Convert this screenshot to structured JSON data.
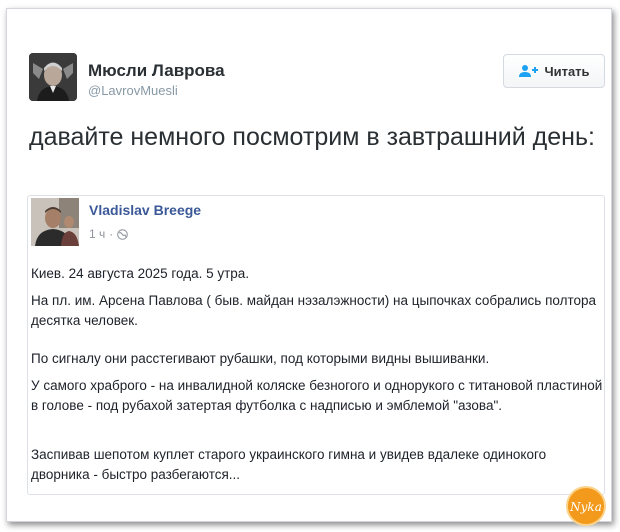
{
  "author": {
    "name": "Мюсли Лаврова",
    "handle": "@LavrovMuesli"
  },
  "follow_button": {
    "label": "Читать",
    "icon": "add-user-icon"
  },
  "tweet": {
    "text": "давайте немного посмотрим в завтрашний день:"
  },
  "embedded_post": {
    "author": "Vladislav Breege",
    "time": "1 ч",
    "visibility_icon": "globe-icon",
    "paragraphs": [
      "Киев. 24 августа 2025 года. 5 утра.",
      "На пл. им. Арсена Павлова ( быв. майдан нэзалэжности) на цыпочках собрались полтора десятка человек.",
      "По сигналу они расстегивают рубашки, под которыми видны вышиванки.",
      "У самого храброго - на инвалидной коляске безногого и однорукого с титановой пластиной в голове - под рубахой затертая футболка с надписью и эмблемой \"азова\".",
      "Заспивав шепотом куплет старого украинского гимна и увидев вдалеке одинокого дворника - быстро разбегаются..."
    ]
  },
  "watermark": {
    "text": "Nyka"
  },
  "colors": {
    "link_blue": "#3b5998",
    "twitter_gray": "#8899a6",
    "follow_icon_blue": "#1da1f2",
    "watermark_orange": "#f39a1d"
  }
}
